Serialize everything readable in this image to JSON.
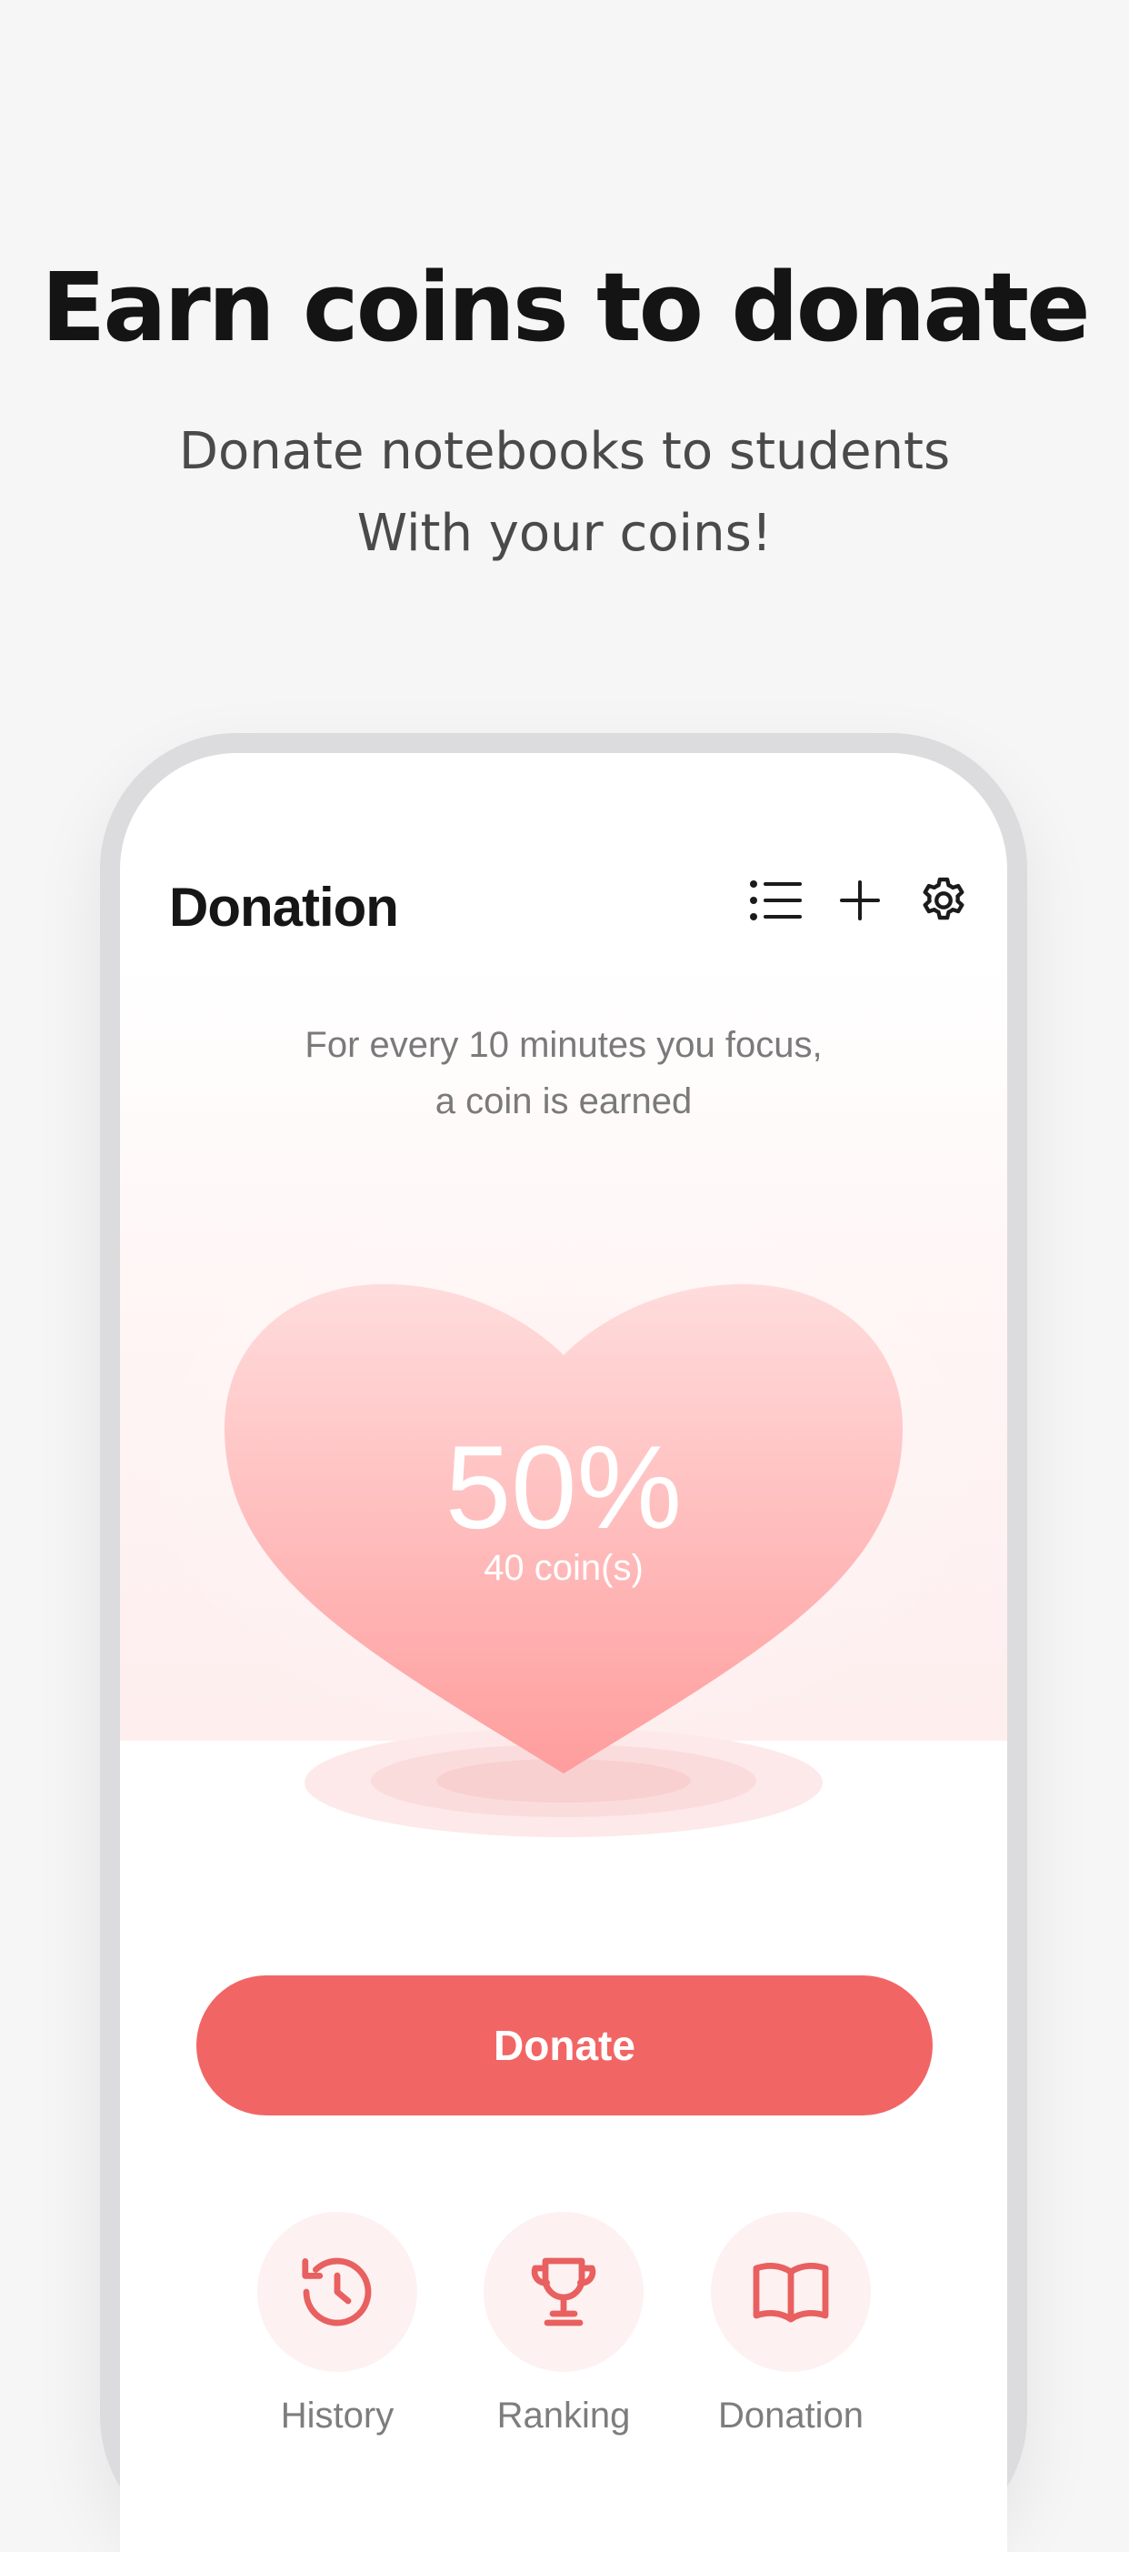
{
  "promo": {
    "title": "Earn coins to donate",
    "subtitle_line1": "Donate notebooks to students",
    "subtitle_line2": "With your coins!"
  },
  "app": {
    "title": "Donation",
    "header_icons": [
      "list-icon",
      "plus-icon",
      "gear-icon"
    ],
    "info_line1": "For every 10 minutes you focus,",
    "info_line2": "a coin is earned",
    "progress_percent_label": "50%",
    "progress_fraction": 0.5,
    "coins_label": "40 coin(s)",
    "donate_button_label": "Donate",
    "nav": [
      {
        "label": "History",
        "icon": "history-icon"
      },
      {
        "label": "Ranking",
        "icon": "trophy-icon"
      },
      {
        "label": "Donation",
        "icon": "book-icon"
      }
    ]
  },
  "colors": {
    "accent": "#f26565",
    "heart_top": "#ffdcdc",
    "heart_bottom": "#ff9d9d",
    "background": "#f6f6f7"
  }
}
